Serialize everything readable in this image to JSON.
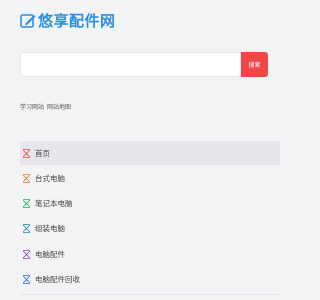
{
  "logo": {
    "text": "悠享配件网",
    "color": "#2b8de6"
  },
  "search": {
    "value": "",
    "placeholder": "",
    "button_label": "搜索",
    "button_color": "#f04646"
  },
  "links": [
    {
      "label": "学习网站"
    },
    {
      "label": "网站地图"
    }
  ],
  "nav": {
    "items": [
      {
        "label": "首页",
        "icon": "hourglass-icon",
        "icon_color": "#e74c3c",
        "active": true
      },
      {
        "label": "台式电脑",
        "icon": "hourglass-icon",
        "icon_color": "#e67e22",
        "active": false
      },
      {
        "label": "笔记本电脑",
        "icon": "hourglass-icon",
        "icon_color": "#27ae60",
        "active": false
      },
      {
        "label": "组装电脑",
        "icon": "hourglass-icon",
        "icon_color": "#2980b9",
        "active": false
      },
      {
        "label": "电脑配件",
        "icon": "hourglass-icon",
        "icon_color": "#8e44ad",
        "active": false
      },
      {
        "label": "电脑配件回收",
        "icon": "hourglass-icon",
        "icon_color": "#2d6fd6",
        "active": false
      }
    ]
  }
}
